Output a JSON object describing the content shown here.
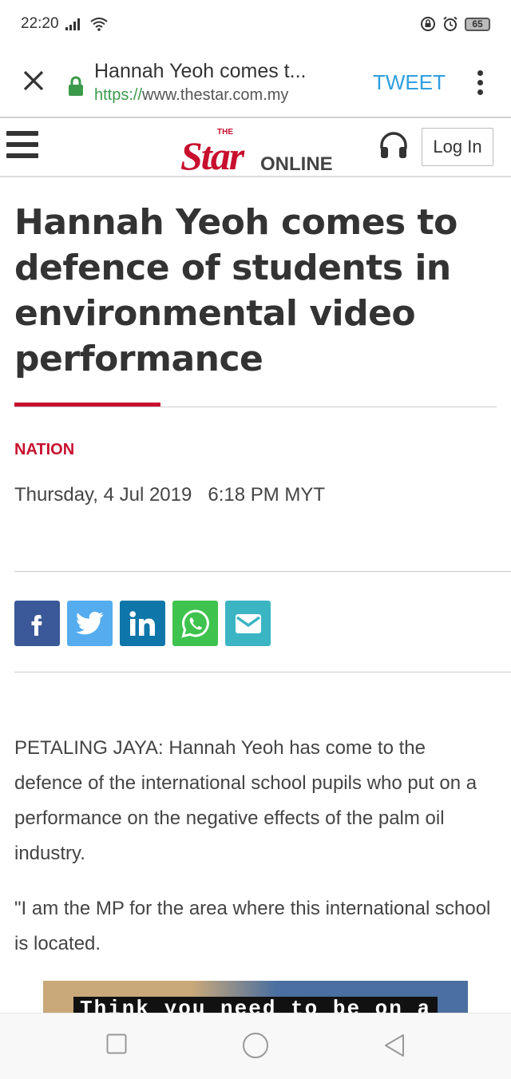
{
  "status_bar": {
    "time": "22:20",
    "battery": "65"
  },
  "browser": {
    "page_title": "Hannah Yeoh comes t...",
    "url_scheme": "https://",
    "url_host": "www.thestar.com.my",
    "tweet_label": "TWEET",
    "colors": {
      "secure": "#3a9a4a",
      "tweet": "#2e9fe0"
    }
  },
  "site": {
    "logo_the": "THE",
    "logo_star": "Star",
    "logo_online": "ONLINE",
    "login_label": "Log In",
    "brand_color": "#c8102e"
  },
  "article": {
    "headline": "Hannah Yeoh comes to defence of students in environmental video performance",
    "category": "NATION",
    "date": "Thursday, 4 Jul 2019",
    "time": "6:18 PM MYT",
    "paragraphs": [
      "PETALING JAYA: Hannah Yeoh has come to the defence of the international school pupils who put on a performance on the negative effects of the palm oil industry.",
      "\"I am the MP for the area where this international school is located."
    ],
    "video_caption": "Think you need to be on a"
  },
  "share_buttons": [
    {
      "name": "facebook",
      "icon": "facebook-icon",
      "color": "#3b5998"
    },
    {
      "name": "twitter",
      "icon": "twitter-icon",
      "color": "#55acee"
    },
    {
      "name": "linkedin",
      "icon": "linkedin-icon",
      "color": "#0e76a8"
    },
    {
      "name": "whatsapp",
      "icon": "whatsapp-icon",
      "color": "#3ec34e"
    },
    {
      "name": "email",
      "icon": "email-icon",
      "color": "#3bb5c4"
    }
  ]
}
